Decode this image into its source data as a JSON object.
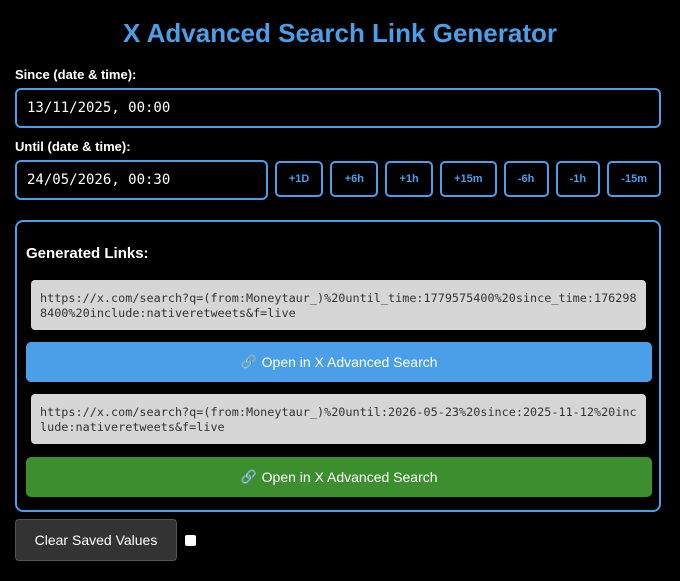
{
  "page": {
    "title": "X Advanced Search Link Generator"
  },
  "since": {
    "label": "Since (date & time):",
    "value": "13/11/2025, 00:00"
  },
  "until": {
    "label": "Until (date & time):",
    "value": "24/05/2026, 00:30",
    "adjust_buttons": [
      "+1D",
      "+6h",
      "+1h",
      "+15m",
      "-6h",
      "-1h",
      "-15m"
    ]
  },
  "links": {
    "title": "Generated Links:",
    "link1": "https://x.com/search?q=(from:Moneytaur_)%20until_time:1779575400%20since_time:1762988400%20include:nativeretweets&f=live",
    "link2": "https://x.com/search?q=(from:Moneytaur_)%20until:2026-05-23%20since:2025-11-12%20include:nativeretweets&f=live",
    "open_label": "Open in X Advanced Search",
    "open_icon": "🔗"
  },
  "controls": {
    "clear_label": "Clear Saved Values"
  },
  "colors": {
    "accent": "#4a9fe8",
    "green": "#3d8e2f"
  }
}
